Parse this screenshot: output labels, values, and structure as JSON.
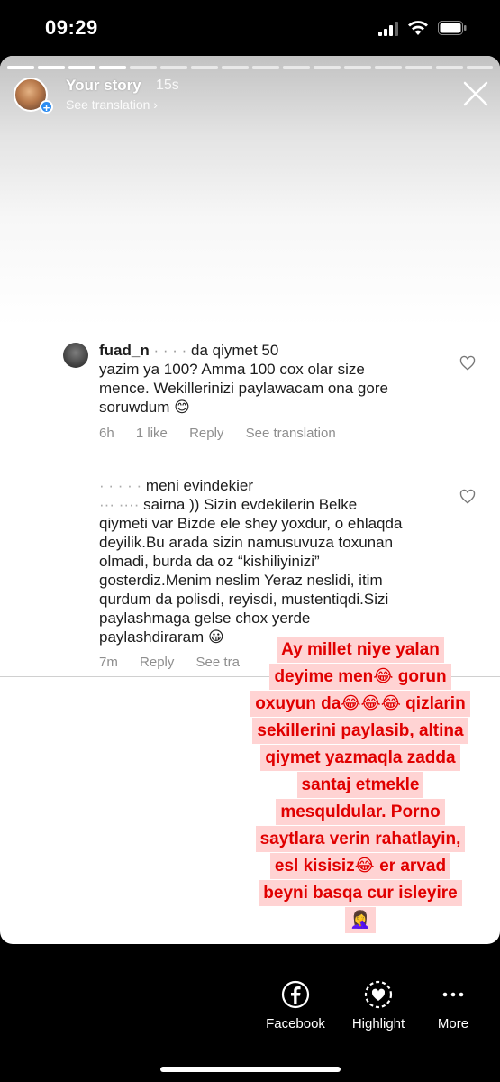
{
  "status_bar": {
    "time": "09:29"
  },
  "story_header": {
    "username": "Your story",
    "time_ago": "15s",
    "see_translation": "See translation ›"
  },
  "comments": [
    {
      "username": "fuad_n",
      "lines": [
        "  da qiymet 50",
        "yazim ya 100? Amma 100 cox olar size",
        "mence. Wekillerinizi paylawacam ona gore",
        "soruwdum 😊"
      ],
      "time": "6h",
      "likes": "1 like",
      "reply": "Reply",
      "see_translation": "See translation"
    },
    {
      "lines": [
        "meni evindekier",
        "sairna )) Sizin evdekilerin Belke",
        "qiymeti var Bizde ele shey yoxdur, o ehlaqda",
        "deyilik.Bu arada sizin namusuvuza toxunan",
        "olmadi, burda da oz “kishiliyinizi”",
        "gosterdiz.Menim neslim Yeraz neslidi, itim",
        "qurdum da polisdi, reyisdi, mustentiqdi.Sizi",
        "paylashmaga gelse chox yerde",
        "paylashdiraram 😀"
      ],
      "time": "7m",
      "reply": "Reply",
      "see_translation": "See tra"
    }
  ],
  "sticker_lines": [
    "Ay millet niye yalan",
    "deyime men😂 gorun",
    "oxuyun da😂😂😂 qizlarin",
    "sekillerini paylasib, altina",
    "qiymet yazmaqla zadda",
    "santaj etmekle",
    "mesquldular. Porno",
    "saytlara verin rahatlayin,",
    "esl kisisiz😂 er arvad",
    "beyni basqa cur isleyire",
    "🤦‍♀️"
  ],
  "bottom_actions": {
    "facebook": "Facebook",
    "highlight": "Highlight",
    "more": "More"
  },
  "colors": {
    "sticker_bg": "#ffd3d3",
    "sticker_text": "#e00000",
    "avatar_plus": "#2b8cf2"
  }
}
